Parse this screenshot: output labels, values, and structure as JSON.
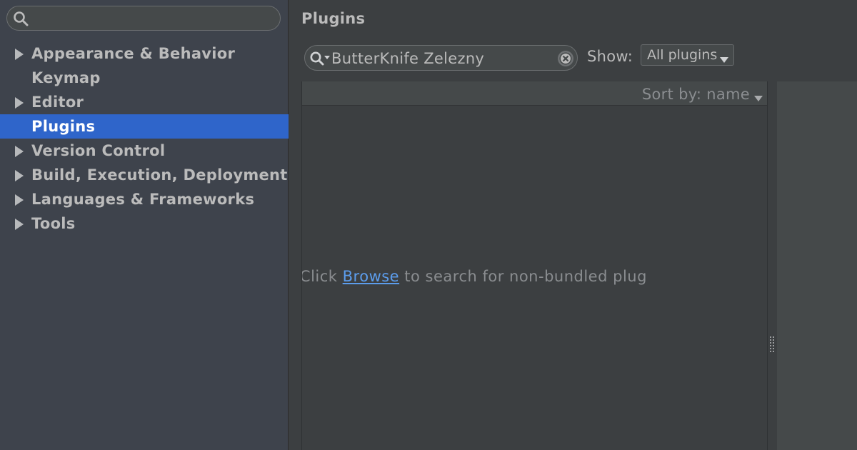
{
  "sidebar": {
    "search": {
      "value": "",
      "placeholder": ""
    },
    "items": [
      {
        "label": "Appearance & Behavior",
        "expandable": true,
        "selected": false
      },
      {
        "label": "Keymap",
        "expandable": false,
        "selected": false
      },
      {
        "label": "Editor",
        "expandable": true,
        "selected": false
      },
      {
        "label": "Plugins",
        "expandable": false,
        "selected": true
      },
      {
        "label": "Version Control",
        "expandable": true,
        "selected": false
      },
      {
        "label": "Build, Execution, Deployment",
        "expandable": true,
        "selected": false
      },
      {
        "label": "Languages & Frameworks",
        "expandable": true,
        "selected": false
      },
      {
        "label": "Tools",
        "expandable": true,
        "selected": false
      }
    ]
  },
  "main": {
    "title": "Plugins",
    "search": {
      "value": "ButterKnife Zelezny"
    },
    "show": {
      "label": "Show:",
      "selected": "All plugins"
    },
    "list": {
      "sort_label": "Sort by: name",
      "empty_before": "hing to show. Click ",
      "empty_link": "Browse",
      "empty_after": " to search for non-bundled plug"
    }
  },
  "colors": {
    "background": "#3c3f41",
    "sidebar": "#3e434c",
    "selection": "#2f65ca",
    "link": "#5c9ded",
    "text": "#bbbbbb",
    "muted_text": "#8a8d90"
  },
  "icons": {
    "sidebar_search": "search-icon",
    "plugin_search": "search-history-icon",
    "clear": "clear-icon",
    "dropdown": "caret-down-icon",
    "tree_expand": "triangle-right-icon"
  }
}
